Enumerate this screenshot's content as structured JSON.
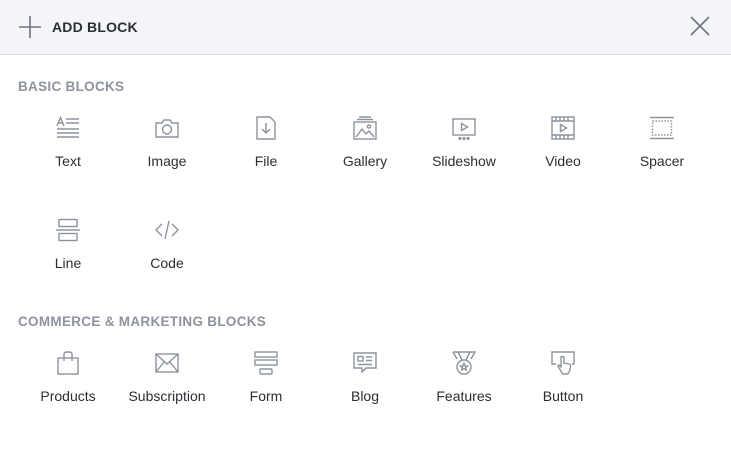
{
  "header": {
    "add_label": "ADD BLOCK"
  },
  "sections": {
    "basic": {
      "title": "BASIC BLOCKS",
      "items": [
        {
          "label": "Text",
          "icon": "text-icon"
        },
        {
          "label": "Image",
          "icon": "camera-icon"
        },
        {
          "label": "File",
          "icon": "file-download-icon"
        },
        {
          "label": "Gallery",
          "icon": "gallery-icon"
        },
        {
          "label": "Slideshow",
          "icon": "slideshow-icon"
        },
        {
          "label": "Video",
          "icon": "video-icon"
        },
        {
          "label": "Spacer",
          "icon": "spacer-icon"
        },
        {
          "label": "Line",
          "icon": "line-icon"
        },
        {
          "label": "Code",
          "icon": "code-icon"
        }
      ]
    },
    "commerce": {
      "title": "COMMERCE & MARKETING BLOCKS",
      "items": [
        {
          "label": "Products",
          "icon": "shopping-bag-icon"
        },
        {
          "label": "Subscription",
          "icon": "envelope-icon"
        },
        {
          "label": "Form",
          "icon": "form-icon"
        },
        {
          "label": "Blog",
          "icon": "blog-icon"
        },
        {
          "label": "Features",
          "icon": "medal-icon"
        },
        {
          "label": "Button",
          "icon": "pointer-hand-icon"
        }
      ]
    }
  },
  "colors": {
    "header_bg": "#f4f5f8",
    "icon_stroke": "#8d939e",
    "text": "#2b2e34",
    "section_title": "#8d939e"
  }
}
